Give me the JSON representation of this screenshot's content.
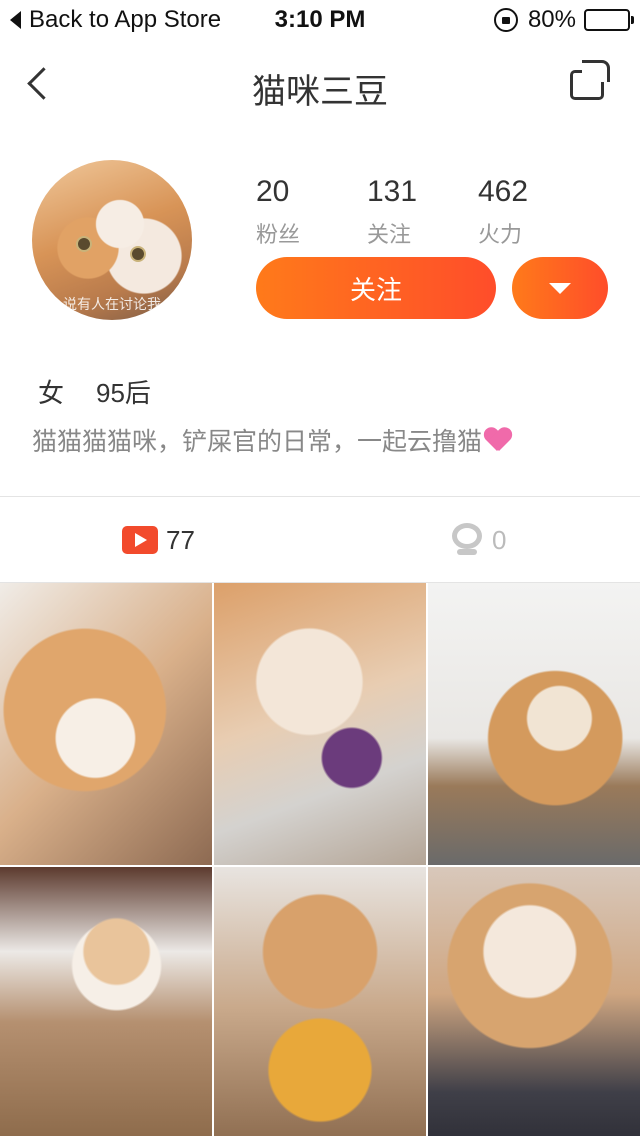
{
  "status_bar": {
    "back_label": "Back to App Store",
    "time": "3:10 PM",
    "battery_percent": "80%",
    "battery_level": 0.8
  },
  "nav": {
    "title": "猫咪三豆",
    "back_icon": "chevron-left-icon",
    "share_icon": "share-icon"
  },
  "profile": {
    "avatar_caption": "说有人在讨论我",
    "stats": [
      {
        "value": "20",
        "label": "粉丝"
      },
      {
        "value": "131",
        "label": "关注"
      },
      {
        "value": "462",
        "label": "火力"
      }
    ],
    "follow_label": "关注",
    "gender": "女",
    "age_group": "95后",
    "bio": "猫猫猫猫咪，铲屎官的日常，一起云撸猫",
    "accent_color": "#ff5a24"
  },
  "tabs": [
    {
      "count": "77",
      "icon": "play-icon"
    },
    {
      "count": "0",
      "icon": "webcam-icon"
    }
  ],
  "grid": {
    "thumbnails": [
      "cat-lying-photo",
      "cat-eating-sweet-potato-photo",
      "cat-beside-bag-photo",
      "cat-in-room-photo",
      "cat-with-toy-photo",
      "cat-sleeping-on-lap-photo"
    ]
  }
}
